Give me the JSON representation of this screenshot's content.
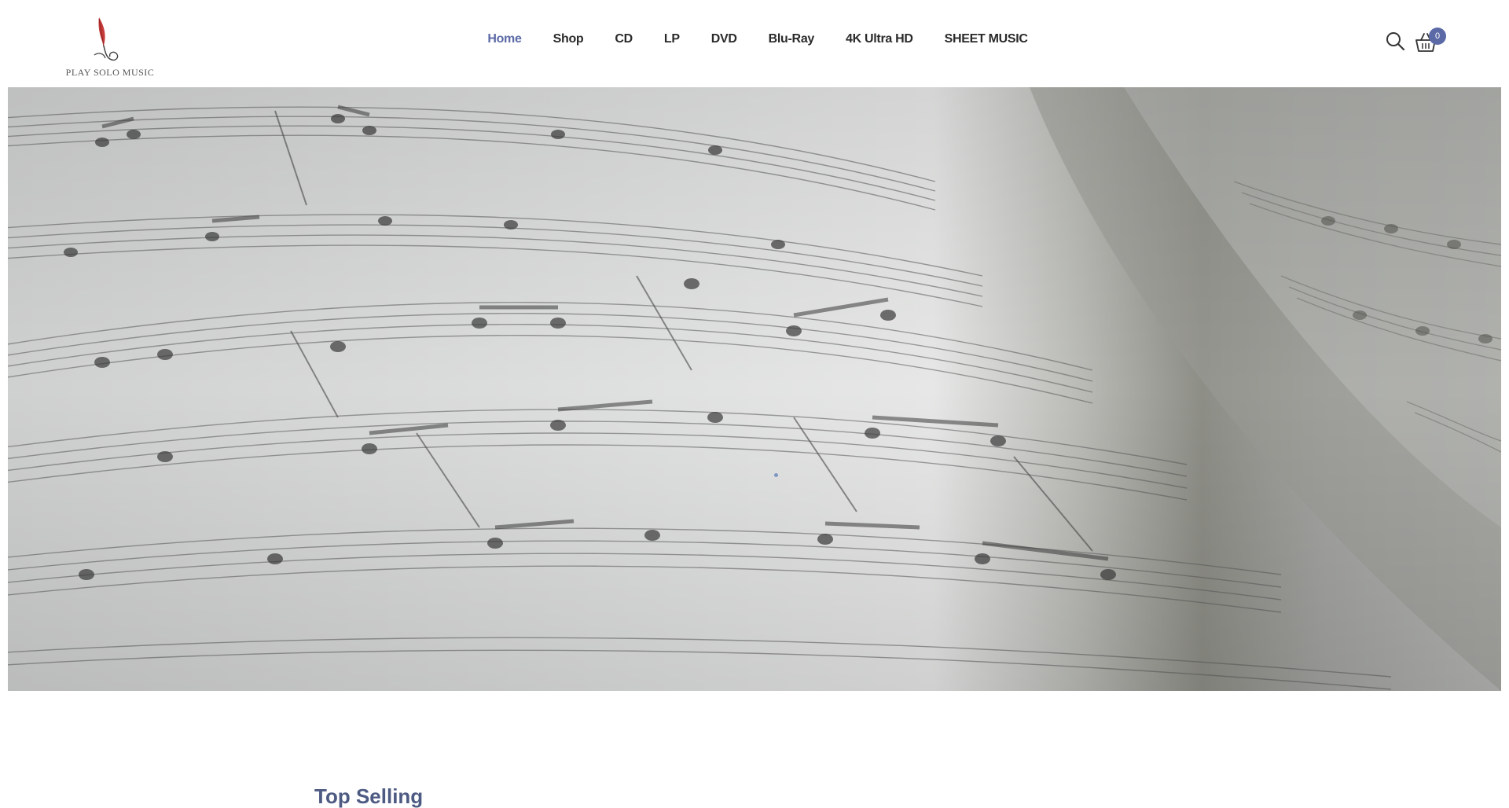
{
  "brand": {
    "logo_text": "PLAY SOLO MUSIC",
    "accent_color": "#c63a3a"
  },
  "nav": {
    "items": [
      {
        "label": "Home",
        "active": true
      },
      {
        "label": "Shop"
      },
      {
        "label": "CD"
      },
      {
        "label": "LP"
      },
      {
        "label": "DVD"
      },
      {
        "label": "Blu-Ray"
      },
      {
        "label": "4K Ultra HD"
      },
      {
        "label": "SHEET MUSIC"
      }
    ],
    "active_color": "#5b6aa6"
  },
  "header_icons": {
    "search_icon": "search-icon",
    "cart_icon": "basket-icon",
    "cart_count": "0"
  },
  "hero": {
    "image": "sheet-music-photo"
  },
  "section": {
    "title": "Top Selling"
  }
}
